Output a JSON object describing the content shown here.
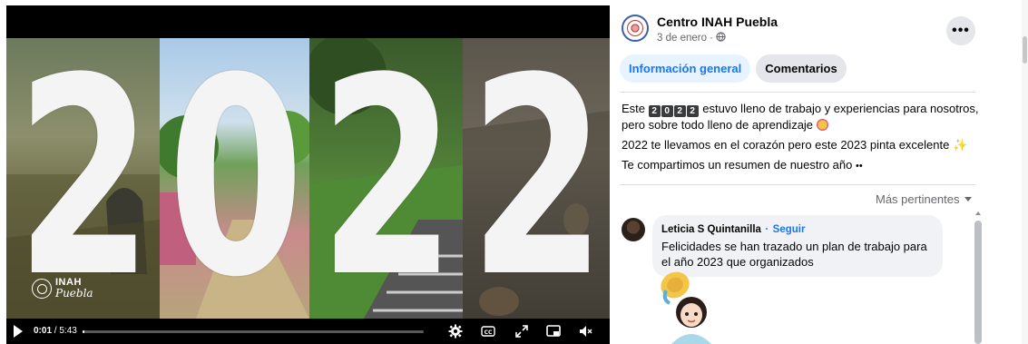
{
  "video": {
    "digits": [
      "2",
      "0",
      "2",
      "2"
    ],
    "logo_line1": "INAH",
    "logo_line2": "Puebla",
    "time_current": "0:01",
    "time_total": "/ 5:43",
    "progress_fraction": 0.003,
    "controls": [
      "settings-icon",
      "captions-icon",
      "fullscreen-icon",
      "picture-in-picture-icon",
      "volume-muted-icon"
    ]
  },
  "post": {
    "page_name": "Centro INAH Puebla",
    "date": "3 de enero ·",
    "more": "•••",
    "tabs": [
      {
        "label": "Información general",
        "active": true
      },
      {
        "label": "Comentarios",
        "active": false
      }
    ],
    "text": {
      "line1_prefix": "Este",
      "year_boxes": [
        "2",
        "0",
        "2",
        "2"
      ],
      "line1_suffix": "estuvo lleno de trabajo y experiencias para nosotros, pero sobre todo lleno de aprendizaje",
      "line2": "2022 te llevamos en el corazón pero este 2023 pinta excelente",
      "line3": "Te compartimos un resumen de nuestro año"
    },
    "sort_label": "Más pertinentes"
  },
  "comment": {
    "author": "Leticia S Quintanilla",
    "separator": "·",
    "follow": "Seguir",
    "text": "Felicidades se han trazado un plan de trabajo para el año 2023 que organizados"
  },
  "colors": {
    "accent": "#1877f2",
    "tab_active_bg": "#e7f3ff",
    "neutral_bg": "#e4e6eb"
  }
}
